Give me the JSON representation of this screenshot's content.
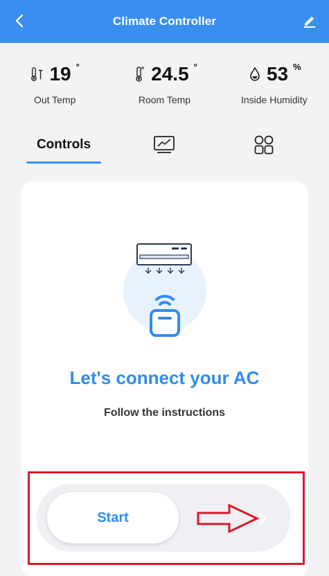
{
  "header": {
    "title": "Climate Controller",
    "back_icon": "chevron-left-icon",
    "edit_icon": "pencil-icon"
  },
  "stats": [
    {
      "value": "19",
      "unit": "°",
      "label": "Out Temp",
      "icon": "thermometer-outdoor-icon"
    },
    {
      "value": "24.5",
      "unit": "°",
      "label": "Room Temp",
      "icon": "thermometer-icon"
    },
    {
      "value": "53",
      "unit": "%",
      "label": "Inside Humidity",
      "icon": "water-drop-icon"
    }
  ],
  "tabs": {
    "controls": "Controls",
    "chart_icon": "monitor-chart-icon",
    "grid_icon": "grid-icon"
  },
  "connect": {
    "title": "Let's connect your AC",
    "subtitle": "Follow the instructions"
  },
  "slider": {
    "start_label": "Start"
  },
  "colors": {
    "accent": "#3a8ef0",
    "highlight": "#d9192a"
  }
}
